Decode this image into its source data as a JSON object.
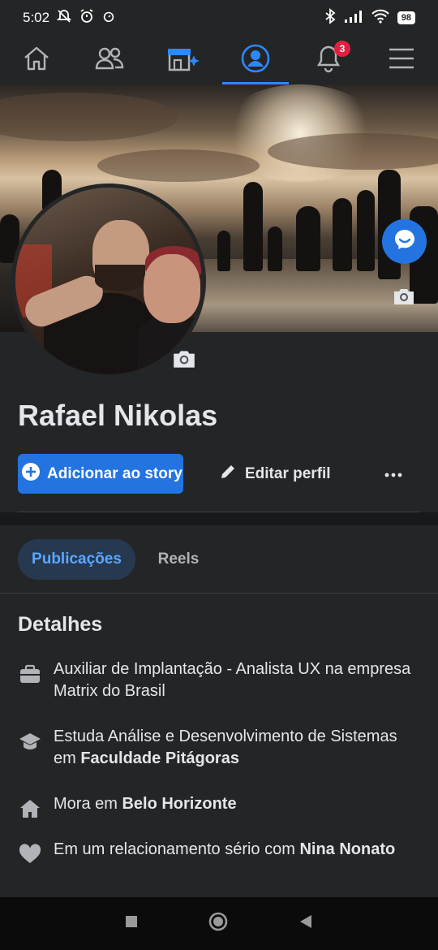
{
  "status_bar": {
    "time": "5:02",
    "battery": "98"
  },
  "top_nav": {
    "notification_count": "3"
  },
  "profile": {
    "name": "Rafael Nikolas"
  },
  "actions": {
    "add_story_label": "Adicionar ao story",
    "edit_profile_label": "Editar perfil",
    "more_label": "•••"
  },
  "tabs": [
    {
      "label": "Publicações",
      "active": true
    },
    {
      "label": "Reels",
      "active": false
    }
  ],
  "details": {
    "title": "Detalhes",
    "work": {
      "text": "Auxiliar de Implantação - Analista UX na empresa Matrix do Brasil"
    },
    "education": {
      "prefix": "Estuda Análise e Desenvolvimento de Sistemas em ",
      "place": "Faculdade Pitágoras"
    },
    "lives": {
      "prefix": "Mora em ",
      "place": "Belo Horizonte"
    },
    "relationship": {
      "prefix": "Em um relacionamento sério com ",
      "person": "Nina Nonato"
    }
  },
  "colors": {
    "accent": "#2374e1",
    "background": "#242526",
    "badge": "#e41e3f"
  }
}
